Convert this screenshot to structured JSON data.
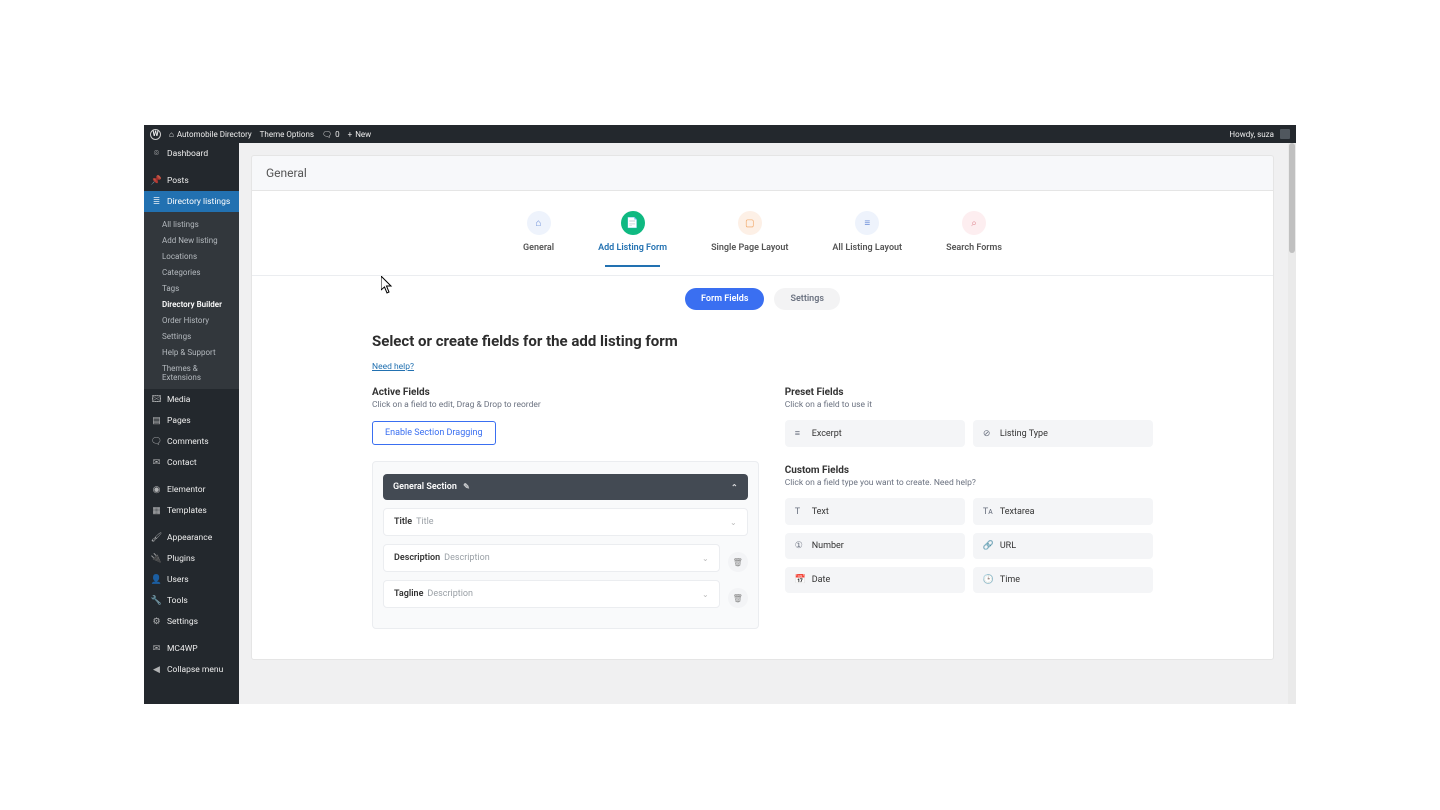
{
  "adminbar": {
    "site_name": "Automobile Directory",
    "theme_options": "Theme Options",
    "comments_count": "0",
    "new_label": "New",
    "howdy": "Howdy, suza"
  },
  "menu": {
    "dashboard": "Dashboard",
    "posts": "Posts",
    "directory_listings": "Directory listings",
    "sub": {
      "all_listings": "All listings",
      "add_new": "Add New listing",
      "locations": "Locations",
      "categories": "Categories",
      "tags": "Tags",
      "directory_builder": "Directory Builder",
      "order_history": "Order History",
      "settings": "Settings",
      "help_support": "Help & Support",
      "themes_ext": "Themes & Extensions"
    },
    "media": "Media",
    "pages": "Pages",
    "comments": "Comments",
    "contact": "Contact",
    "elementor": "Elementor",
    "templates": "Templates",
    "appearance": "Appearance",
    "plugins": "Plugins",
    "users": "Users",
    "tools": "Tools",
    "settings": "Settings",
    "mc4wp": "MC4WP",
    "collapse": "Collapse menu"
  },
  "panel": {
    "header": "General"
  },
  "steps": {
    "general": "General",
    "add_listing_form": "Add Listing Form",
    "single_page_layout": "Single Page Layout",
    "all_listing_layout": "All Listing Layout",
    "search_forms": "Search Forms"
  },
  "subtabs": {
    "form_fields": "Form Fields",
    "settings": "Settings"
  },
  "builder": {
    "heading": "Select or create fields for the add listing form",
    "need_help": "Need help?",
    "active_fields": {
      "title": "Active Fields",
      "hint": "Click on a field to edit, Drag & Drop to reorder",
      "enable_dragging": "Enable Section Dragging",
      "section_label": "General Section",
      "rows": [
        {
          "label": "Title",
          "type": "Title"
        },
        {
          "label": "Description",
          "type": "Description"
        },
        {
          "label": "Tagline",
          "type": "Description"
        }
      ]
    },
    "preset": {
      "title": "Preset Fields",
      "hint": "Click on a field to use it",
      "items": [
        {
          "icon": "≡",
          "label": "Excerpt"
        },
        {
          "icon": "⊘",
          "label": "Listing Type"
        }
      ]
    },
    "custom": {
      "title": "Custom Fields",
      "hint": "Click on a field type you want to create. Need help?",
      "items": [
        {
          "icon": "T",
          "label": "Text"
        },
        {
          "icon": "Tᴀ",
          "label": "Textarea"
        },
        {
          "icon": "①",
          "label": "Number"
        },
        {
          "icon": "🔗",
          "label": "URL"
        },
        {
          "icon": "📅",
          "label": "Date"
        },
        {
          "icon": "🕒",
          "label": "Time"
        }
      ]
    }
  },
  "colors": {
    "accent": "#3a6ff1",
    "teal": "#0fb981",
    "wp_blue": "#2271b1"
  }
}
